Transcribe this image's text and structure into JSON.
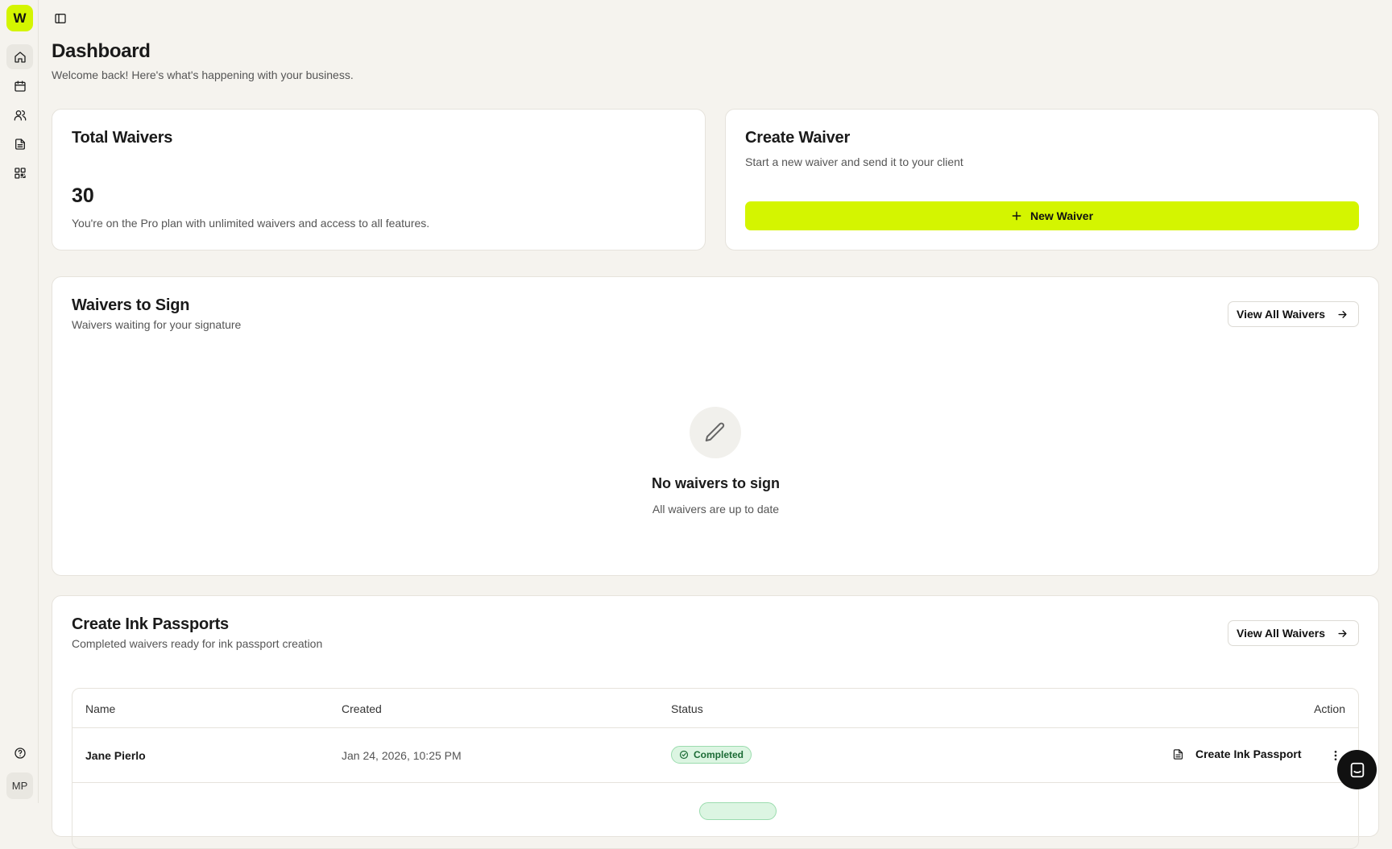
{
  "sidebar": {
    "logo_letter": "W",
    "avatar_initials": "MP"
  },
  "header": {
    "title": "Dashboard",
    "subtitle": "Welcome back! Here's what's happening with your business."
  },
  "total_waivers": {
    "title": "Total Waivers",
    "count": "30",
    "note": "You're on the Pro plan with unlimited waivers and access to all features."
  },
  "create_waiver": {
    "title": "Create Waiver",
    "subtitle": "Start a new waiver and send it to your client",
    "button_label": "New Waiver"
  },
  "waivers_to_sign": {
    "title": "Waivers to Sign",
    "subtitle": "Waivers waiting for your signature",
    "view_all_label": "View All Waivers",
    "empty_title": "No waivers to sign",
    "empty_subtitle": "All waivers are up to date"
  },
  "ink_passports": {
    "title": "Create Ink Passports",
    "subtitle": "Completed waivers ready for ink passport creation",
    "view_all_label": "View All Waivers",
    "columns": {
      "name": "Name",
      "created": "Created",
      "status": "Status",
      "action": "Action"
    },
    "rows": [
      {
        "name": "Jane Pierlo",
        "created": "Jan 24, 2026, 10:25 PM",
        "status": "Completed",
        "action": "Create Ink Passport"
      }
    ]
  },
  "colors": {
    "accent": "#d4f500",
    "background": "#f5f3ee",
    "status_completed_bg": "#dcf5e2",
    "status_completed_text": "#1b6b35"
  }
}
